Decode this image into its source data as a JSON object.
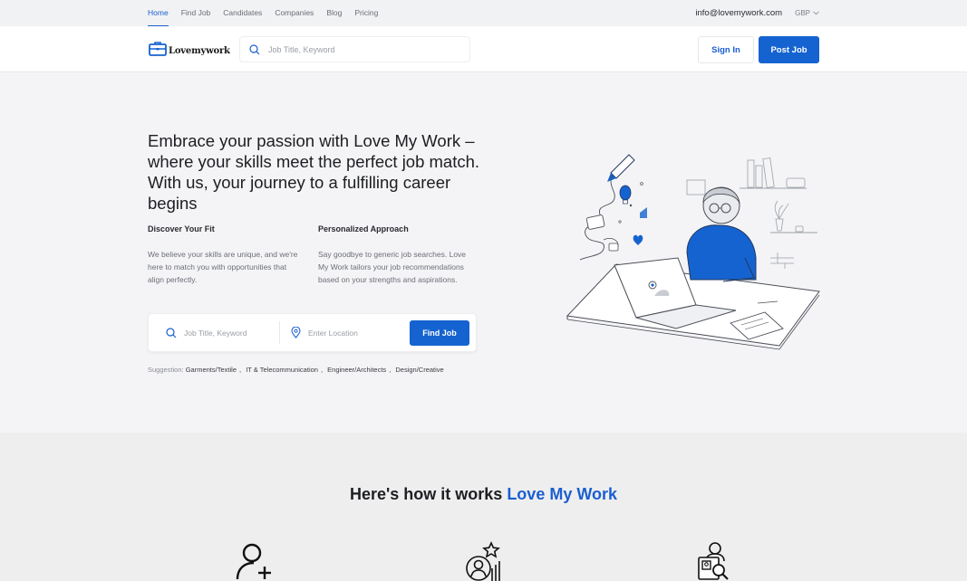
{
  "topbar": {
    "nav": [
      "Home",
      "Find Job",
      "Candidates",
      "Companies",
      "Blog",
      "Pricing"
    ],
    "email": "info@lovemywork.com",
    "currency": "GBP"
  },
  "header": {
    "logo_text": "Lovemywork",
    "search_placeholder": "Job Title, Keyword",
    "signin_label": "Sign In",
    "postjob_label": "Post Job"
  },
  "hero": {
    "title": "Embrace your passion with Love My Work – where your skills meet the perfect job match. With us, your journey to a fulfilling career begins",
    "features": [
      {
        "title": "Discover Your Fit",
        "text": "We believe your skills are unique, and we're here to match you with opportunities that align perfectly."
      },
      {
        "title": "Personalized Approach",
        "text": "Say goodbye to generic job searches. Love My Work tailors your job recommendations based on your strengths and aspirations."
      }
    ],
    "search": {
      "keyword_placeholder": "Job Title, Keyword",
      "location_placeholder": "Enter Location",
      "button_label": "Find Job"
    },
    "suggestion_label": "Suggestion:",
    "suggestions": [
      "Garments/Textile",
      "IT & Telecommunication",
      "Engineer/Architects",
      "Design/Creative"
    ]
  },
  "how": {
    "title_prefix": "Here's how it works ",
    "title_accent": "Love My Work"
  },
  "colors": {
    "primary": "#1563d0",
    "accent_text": "#1a5fcf"
  },
  "icons": [
    "search-icon",
    "location-pin-icon",
    "briefcase-logo-icon",
    "chevron-down-icon",
    "add-user-icon",
    "rating-user-icon",
    "document-search-icon"
  ]
}
